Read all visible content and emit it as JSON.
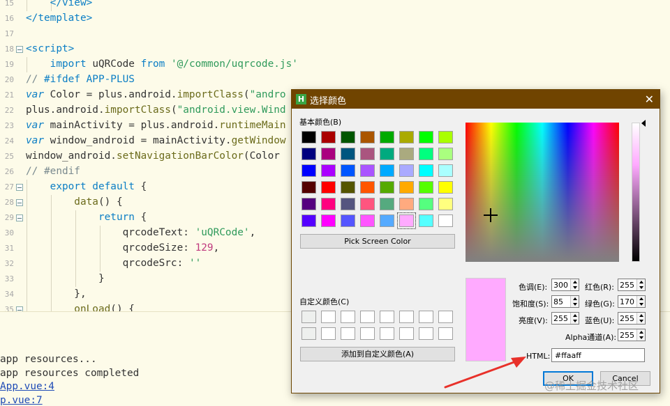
{
  "editor": {
    "lines": [
      {
        "n": "15",
        "indent": 2,
        "fold": false,
        "tokens": [
          {
            "t": "    </view>",
            "c": "kw"
          }
        ]
      },
      {
        "n": "16",
        "indent": 0,
        "fold": false,
        "tokens": [
          {
            "t": "</template>",
            "c": "kw"
          }
        ]
      },
      {
        "n": "17",
        "indent": 0,
        "fold": false,
        "tokens": []
      },
      {
        "n": "18",
        "indent": 0,
        "fold": true,
        "tokens": [
          {
            "t": "<script>",
            "c": "kw"
          }
        ]
      },
      {
        "n": "19",
        "indent": 1,
        "fold": false,
        "tokens": [
          {
            "t": "    import ",
            "c": "kw"
          },
          {
            "t": "uQRCode ",
            "c": ""
          },
          {
            "t": "from ",
            "c": "kw"
          },
          {
            "t": "'@/common/uqrcode.js'",
            "c": "str"
          }
        ]
      },
      {
        "n": "20",
        "indent": 0,
        "fold": false,
        "tokens": [
          {
            "t": "// ",
            "c": "cm"
          },
          {
            "t": "#ifdef APP-PLUS",
            "c": "kw"
          }
        ]
      },
      {
        "n": "21",
        "indent": 0,
        "fold": false,
        "tokens": [
          {
            "t": "var ",
            "c": "kwi"
          },
          {
            "t": "Color = plus.android.",
            "c": ""
          },
          {
            "t": "importClass",
            "c": "fn"
          },
          {
            "t": "(",
            "c": ""
          },
          {
            "t": "\"andro",
            "c": "str"
          }
        ]
      },
      {
        "n": "22",
        "indent": 0,
        "fold": false,
        "tokens": [
          {
            "t": "plus.android.",
            "c": ""
          },
          {
            "t": "importClass",
            "c": "fn"
          },
          {
            "t": "(",
            "c": ""
          },
          {
            "t": "\"android.view.Wind",
            "c": "str"
          }
        ]
      },
      {
        "n": "23",
        "indent": 0,
        "fold": false,
        "tokens": [
          {
            "t": "var ",
            "c": "kwi"
          },
          {
            "t": "mainActivity = plus.android.",
            "c": ""
          },
          {
            "t": "runtimeMain",
            "c": "fn"
          }
        ]
      },
      {
        "n": "24",
        "indent": 0,
        "fold": false,
        "tokens": [
          {
            "t": "var ",
            "c": "kwi"
          },
          {
            "t": "window_android = mainActivity.",
            "c": ""
          },
          {
            "t": "getWindow",
            "c": "fn"
          }
        ]
      },
      {
        "n": "25",
        "indent": 0,
        "fold": false,
        "tokens": [
          {
            "t": "window_android.",
            "c": ""
          },
          {
            "t": "setNavigationBarColor",
            "c": "fn"
          },
          {
            "t": "(Color",
            "c": ""
          }
        ]
      },
      {
        "n": "26",
        "indent": 0,
        "fold": false,
        "tokens": [
          {
            "t": "// #endif",
            "c": "cm"
          }
        ]
      },
      {
        "n": "27",
        "indent": 1,
        "fold": true,
        "tokens": [
          {
            "t": "    export default ",
            "c": "kw"
          },
          {
            "t": "{",
            "c": ""
          }
        ]
      },
      {
        "n": "28",
        "indent": 2,
        "fold": true,
        "tokens": [
          {
            "t": "        data",
            "c": "fn"
          },
          {
            "t": "() {",
            "c": ""
          }
        ]
      },
      {
        "n": "29",
        "indent": 3,
        "fold": true,
        "tokens": [
          {
            "t": "            return ",
            "c": "kw"
          },
          {
            "t": "{",
            "c": ""
          }
        ]
      },
      {
        "n": "30",
        "indent": 4,
        "fold": false,
        "tokens": [
          {
            "t": "                qrcodeText: ",
            "c": ""
          },
          {
            "t": "'uQRCode'",
            "c": "str"
          },
          {
            "t": ",",
            "c": ""
          }
        ]
      },
      {
        "n": "31",
        "indent": 4,
        "fold": false,
        "tokens": [
          {
            "t": "                qrcodeSize: ",
            "c": ""
          },
          {
            "t": "129",
            "c": "num"
          },
          {
            "t": ",",
            "c": ""
          }
        ]
      },
      {
        "n": "32",
        "indent": 4,
        "fold": false,
        "tokens": [
          {
            "t": "                qrcodeSrc: ",
            "c": ""
          },
          {
            "t": "''",
            "c": "str"
          }
        ]
      },
      {
        "n": "33",
        "indent": 3,
        "fold": false,
        "tokens": [
          {
            "t": "            }",
            "c": ""
          }
        ]
      },
      {
        "n": "34",
        "indent": 2,
        "fold": false,
        "tokens": [
          {
            "t": "        },",
            "c": ""
          }
        ]
      },
      {
        "n": "35",
        "indent": 2,
        "fold": true,
        "tokens": [
          {
            "t": "        onLoad",
            "c": "fn"
          },
          {
            "t": "() {",
            "c": ""
          }
        ]
      }
    ]
  },
  "console": {
    "lines": [
      {
        "text": "app resources...",
        "link": false
      },
      {
        "text": "app resources completed",
        "link": false
      },
      {
        "text": "App.vue:4",
        "link": true
      },
      {
        "text": "p.vue:7",
        "link": true
      }
    ]
  },
  "dialog": {
    "icon_letter": "H",
    "title": "选择颜色",
    "close_symbol": "✕",
    "basic_colors_label": "基本颜色(B)",
    "basic_colors": [
      [
        "#000000",
        "#aa0000",
        "#005500",
        "#aa5500",
        "#00aa00",
        "#aaaa00",
        "#00ff00",
        "#aaff00"
      ],
      [
        "#00007f",
        "#aa007f",
        "#00557f",
        "#aa557f",
        "#00aa7f",
        "#aaaa7f",
        "#00ff7f",
        "#aaff7f"
      ],
      [
        "#0000ff",
        "#aa00ff",
        "#0055ff",
        "#aa55ff",
        "#00aaff",
        "#aaaaff",
        "#00ffff",
        "#aaffff"
      ],
      [
        "#550000",
        "#ff0000",
        "#555500",
        "#ff5500",
        "#55aa00",
        "#ffaa00",
        "#55ff00",
        "#ffff00"
      ],
      [
        "#55007f",
        "#ff007f",
        "#55557f",
        "#ff557f",
        "#55aa7f",
        "#ffaa7f",
        "#55ff7f",
        "#ffff7f"
      ],
      [
        "#5500ff",
        "#ff00ff",
        "#5555ff",
        "#ff55ff",
        "#55aaff",
        "#ffaaff",
        "#55ffff",
        "#ffffff"
      ]
    ],
    "selected_swatch": "#ffaaff",
    "pick_screen_label": "Pick Screen Color",
    "custom_colors_label": "自定义颜色(C)",
    "add_custom_label": "添加到自定义颜色(A)",
    "fields": {
      "hue_label": "色调(E):",
      "hue": "300",
      "sat_label": "饱和度(S):",
      "sat": "85",
      "val_label": "亮度(V):",
      "val": "255",
      "red_label": "红色(R):",
      "red": "255",
      "green_label": "绿色(G):",
      "green": "170",
      "blue_label": "蓝色(U):",
      "blue": "255",
      "alpha_label": "Alpha通道(A):",
      "alpha": "255"
    },
    "html_label": "HTML:",
    "html_value": "#ffaaff",
    "ok_label": "OK",
    "cancel_label": "Cancel"
  },
  "annotation": {
    "arrow_color": "#e8312a"
  },
  "watermark": "@稀土掘金技术社区"
}
